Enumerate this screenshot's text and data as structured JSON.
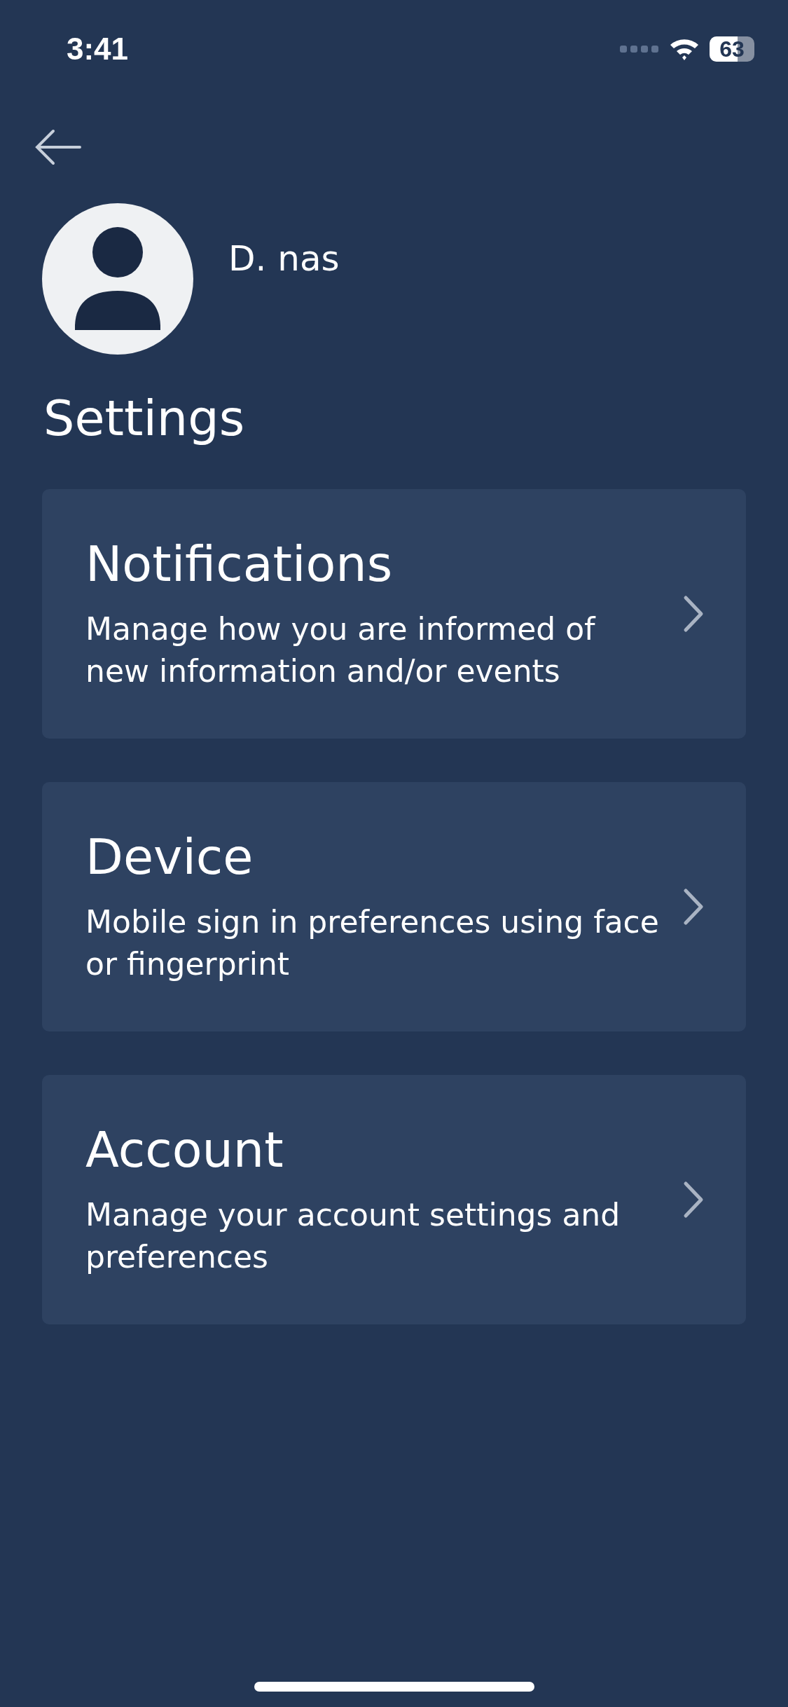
{
  "status_bar": {
    "time": "3:41",
    "battery": "63"
  },
  "profile": {
    "name": "D. nas"
  },
  "title": "Settings",
  "items": [
    {
      "title": "Notifications",
      "description": "Manage how you are informed of new information and/or events"
    },
    {
      "title": "Device",
      "description": "Mobile sign in preferences using face or fingerprint"
    },
    {
      "title": "Account",
      "description": "Manage your account settings and preferences"
    }
  ]
}
